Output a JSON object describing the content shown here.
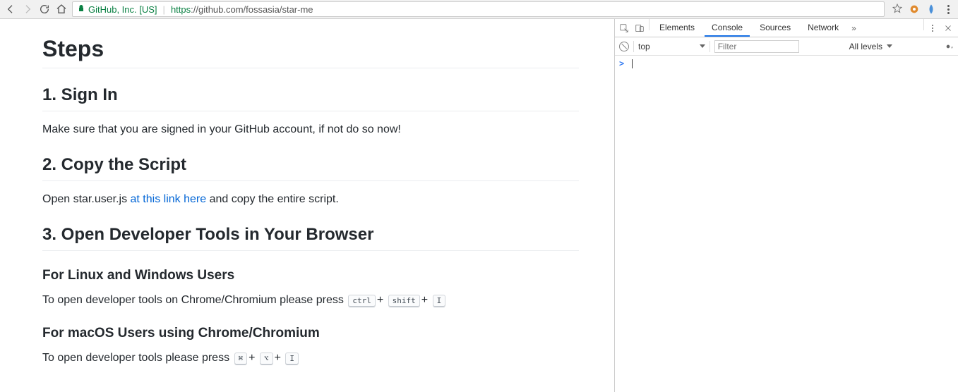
{
  "toolbar": {
    "identity": "GitHub, Inc. [US]",
    "url_proto": "https",
    "url_rest": "://github.com/fossasia/star-me"
  },
  "page": {
    "h1": "Steps",
    "s1": {
      "title": "1. Sign In",
      "body": "Make sure that you are signed in your GitHub account, if not do so now!"
    },
    "s2": {
      "title": "2. Copy the Script",
      "body_pre": "Open star.user.js ",
      "link": "at this link here",
      "body_post": " and copy the entire script."
    },
    "s3": {
      "title": "3. Open Developer Tools in Your Browser",
      "linux": {
        "heading": "For Linux and Windows Users",
        "pre": "To open developer tools on Chrome/Chromium please press ",
        "k1": "ctrl",
        "plus1": "+",
        "k2": "shift",
        "plus2": "+",
        "k3": "I"
      },
      "mac": {
        "heading": "For macOS Users using Chrome/Chromium",
        "pre": "To open developer tools please press ",
        "k1": "⌘",
        "plus1": "+",
        "k2": "⌥",
        "plus2": "+",
        "k3": "I"
      }
    }
  },
  "devtools": {
    "tabs": {
      "elements": "Elements",
      "console": "Console",
      "sources": "Sources",
      "network": "Network",
      "more": "»"
    },
    "subbar": {
      "context": "top",
      "filter_placeholder": "Filter",
      "levels": "All levels"
    },
    "prompt": ">"
  }
}
